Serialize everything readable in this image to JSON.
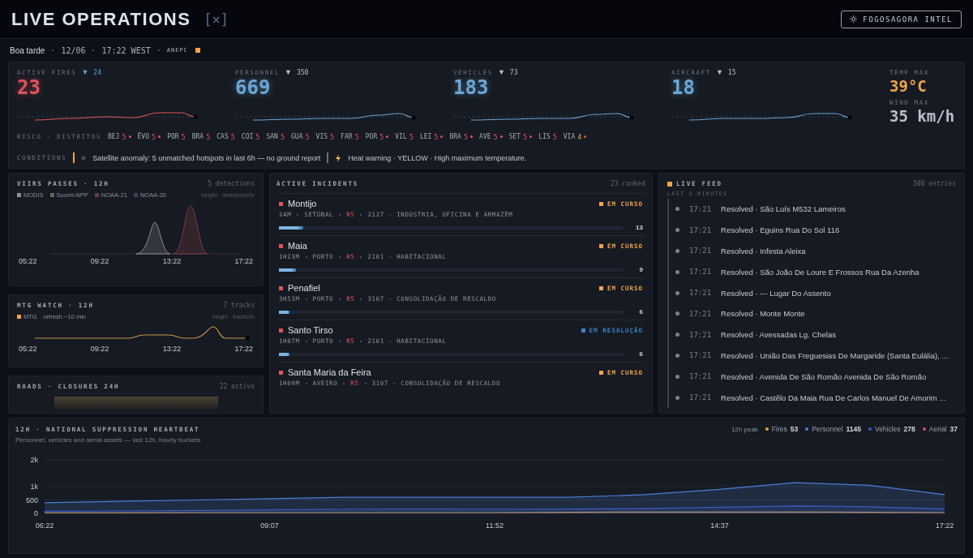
{
  "header": {
    "title": "LIVE OPERATIONS",
    "close_mark": "[×]",
    "intel_button": "FOGOSAGORA INTEL"
  },
  "subbar": {
    "greeting": "Boa tarde",
    "date": "12/06",
    "time": "17:22 WEST",
    "agency": "ANEPC"
  },
  "kpis": [
    {
      "label": "ACTIVE FIRES",
      "trend": "▼",
      "trend_highlight": true,
      "delta": "24",
      "value": "23",
      "color": "#e0555a"
    },
    {
      "label": "PERSONNEL",
      "trend": "▼",
      "trend_highlight": false,
      "delta": "350",
      "value": "669",
      "color": "#6aa6d6"
    },
    {
      "label": "VEHICLES",
      "trend": "▼",
      "trend_highlight": false,
      "delta": "73",
      "value": "183",
      "color": "#6aa6d6"
    },
    {
      "label": "AIRCRAFT",
      "trend": "▼",
      "trend_highlight": false,
      "delta": "15",
      "value": "18",
      "color": "#6aa6d6"
    }
  ],
  "weather": [
    {
      "label": "TEMP MAX",
      "value": "39°C",
      "color": "#f0a54a"
    },
    {
      "label": "WIND MAX",
      "value": "35 km/h",
      "color": "#b8c0cc"
    }
  ],
  "risk": {
    "label": "RISCO · DISTRITOS",
    "districts": [
      {
        "code": "BEJ",
        "level": "5",
        "alert": true
      },
      {
        "code": "ÉVO",
        "level": "5",
        "alert": true
      },
      {
        "code": "POR",
        "level": "5",
        "alert": false
      },
      {
        "code": "BRA",
        "level": "5",
        "alert": false
      },
      {
        "code": "CAS",
        "level": "5",
        "alert": false
      },
      {
        "code": "COI",
        "level": "5",
        "alert": false
      },
      {
        "code": "SAN",
        "level": "5",
        "alert": false
      },
      {
        "code": "GUA",
        "level": "5",
        "alert": false
      },
      {
        "code": "VIS",
        "level": "5",
        "alert": false
      },
      {
        "code": "FAR",
        "level": "5",
        "alert": false
      },
      {
        "code": "POR",
        "level": "5",
        "alert": true
      },
      {
        "code": "VIL",
        "level": "5",
        "alert": false
      },
      {
        "code": "LEI",
        "level": "5",
        "alert": true
      },
      {
        "code": "BRA",
        "level": "5",
        "alert": true
      },
      {
        "code": "AVE",
        "level": "5",
        "alert": true
      },
      {
        "code": "SET",
        "level": "5",
        "alert": true
      },
      {
        "code": "LIS",
        "level": "5",
        "alert": false
      },
      {
        "code": "VIA",
        "level": "4",
        "alert": true
      }
    ]
  },
  "conditions": {
    "label": "CONDITIONS",
    "items": [
      {
        "kind": "satellite",
        "text": "Satellite anomaly: 5 unmatched hotspots in last 6h — no ground report"
      },
      {
        "kind": "heat",
        "text": "Heat warning · YELLOW · High maximum temperature."
      }
    ]
  },
  "viirs": {
    "title": "VIIRS PASSES · 12H",
    "count": "5 detections",
    "legend": [
      {
        "name": "MODIS",
        "color": "#8a8d94"
      },
      {
        "name": "Suomi-NPP",
        "color": "#6b6558"
      },
      {
        "name": "NOAA-21",
        "color": "#6a3a40"
      },
      {
        "name": "NOAA-20",
        "color": "#3a4258"
      }
    ],
    "axis_note": "height · detections/hr",
    "axis_labels": [
      "05:22",
      "09:22",
      "13:22",
      "17:22"
    ]
  },
  "mtg": {
    "title": "MTG WATCH · 12H",
    "count": "7 tracks",
    "legend": [
      {
        "name": "MTG",
        "color": "#f0a54a"
      }
    ],
    "refresh": "refresh ~10 min",
    "axis_note": "height · tracks/hr",
    "axis_labels": [
      "05:22",
      "09:22",
      "13:22",
      "17:22"
    ]
  },
  "roads": {
    "title": "ROADS · CLOSURES 24H",
    "count": "22 active"
  },
  "incidents": {
    "title": "ACTIVE INCIDENTS",
    "count": "23 ranked",
    "items": [
      {
        "name": "Montijo",
        "age": "24M",
        "district": "SETÚBAL",
        "risk": "R5",
        "type": "2127 - INDÚSTRIA, OFICINA E ARMAZÉM",
        "status": {
          "kind": "active",
          "label": "EM CURSO"
        },
        "level": 0.07,
        "resources": "13"
      },
      {
        "name": "Maia",
        "age": "1H23M",
        "district": "PORTO",
        "risk": "R5",
        "type": "2101 - HABITACIONAL",
        "status": {
          "kind": "active",
          "label": "EM CURSO"
        },
        "level": 0.05,
        "resources": "9"
      },
      {
        "name": "Penafiel",
        "age": "3H53M",
        "district": "PORTO",
        "risk": "R5",
        "type": "3107 - CONSOLIDAÇÃO DE RESCALDO",
        "status": {
          "kind": "active",
          "label": "EM CURSO"
        },
        "level": 0.03,
        "resources": "6"
      },
      {
        "name": "Santo Tirso",
        "age": "1H07M",
        "district": "PORTO",
        "risk": "R5",
        "type": "2101 - HABITACIONAL",
        "status": {
          "kind": "resolving",
          "label": "EM RESOLUÇÃO"
        },
        "level": 0.03,
        "resources": "6"
      },
      {
        "name": "Santa Maria da Feira",
        "age": "1H09M",
        "district": "AVEIRO",
        "risk": "R5",
        "type": "3107 - CONSOLIDAÇÃO DE RESCALDO",
        "status": {
          "kind": "active",
          "label": "EM CURSO"
        }
      }
    ]
  },
  "feed": {
    "title": "LIVE FEED",
    "count": "500 entries",
    "window": "LAST 5 MINUTES",
    "entries": [
      {
        "time": "17:21",
        "text": "Resolved · São Luís M532 Lameiros"
      },
      {
        "time": "17:21",
        "text": "Resolved · Eguins Rua Do Sol 116"
      },
      {
        "time": "17:21",
        "text": "Resolved · Infesta Aleixa"
      },
      {
        "time": "17:21",
        "text": "Resolved · São João De Loure E Frossos Rua Da Azenha"
      },
      {
        "time": "17:21",
        "text": "Resolved · --- Lugar Do Assento"
      },
      {
        "time": "17:21",
        "text": "Resolved · Monte Monte"
      },
      {
        "time": "17:21",
        "text": "Resolved · Avessadas Lg. Chelas"
      },
      {
        "time": "17:21",
        "text": "Resolved · União Das Freguesias De Margaride (Santa Eulália), ..."
      },
      {
        "time": "17:21",
        "text": "Resolved · Avenida De São Romão Avenida De São Romão"
      },
      {
        "time": "17:21",
        "text": "Resolved · Castêlo Da Maia Rua De Carlos Manuel De Amorim ..."
      }
    ]
  },
  "heartbeat": {
    "title": "12H · NATIONAL SUPPRESSION HEARTBEAT",
    "subtitle": "Personnel, vehicles and aerial assets — last 12h, hourly buckets",
    "peak_label": "12h peak",
    "peaks": [
      {
        "value": "53"
      },
      {
        "value": "1145"
      },
      {
        "value": "278"
      },
      {
        "name": "Aerial",
        "value": "37",
        "color": "#d0505a"
      }
    ],
    "chart_data": {
      "type": "area",
      "categories": [
        "06:22",
        null,
        null,
        "09:07",
        null,
        null,
        "11:52",
        null,
        null,
        "14:37",
        null,
        null,
        "17:22"
      ],
      "ylim": [
        0,
        2000
      ],
      "yticks": [
        {
          "value": 0,
          "label": "0"
        },
        {
          "value": 500,
          "label": "500"
        },
        {
          "value": 1000,
          "label": "1k"
        },
        {
          "value": 2000,
          "label": "2k"
        }
      ],
      "series": [
        {
          "name": "Fires",
          "color": "#e8a040",
          "values": [
            20,
            20,
            30,
            30,
            30,
            30,
            30,
            40,
            50,
            50,
            50,
            40,
            30
          ]
        },
        {
          "name": "Personnel",
          "color": "#4a7fd8",
          "values": [
            400,
            450,
            500,
            550,
            600,
            600,
            600,
            600,
            700,
            900,
            1150,
            1050,
            700
          ]
        },
        {
          "name": "Vehicles",
          "color": "#3c5cc4",
          "values": [
            80,
            90,
            110,
            130,
            150,
            160,
            150,
            160,
            180,
            230,
            280,
            250,
            160
          ]
        }
      ]
    }
  }
}
